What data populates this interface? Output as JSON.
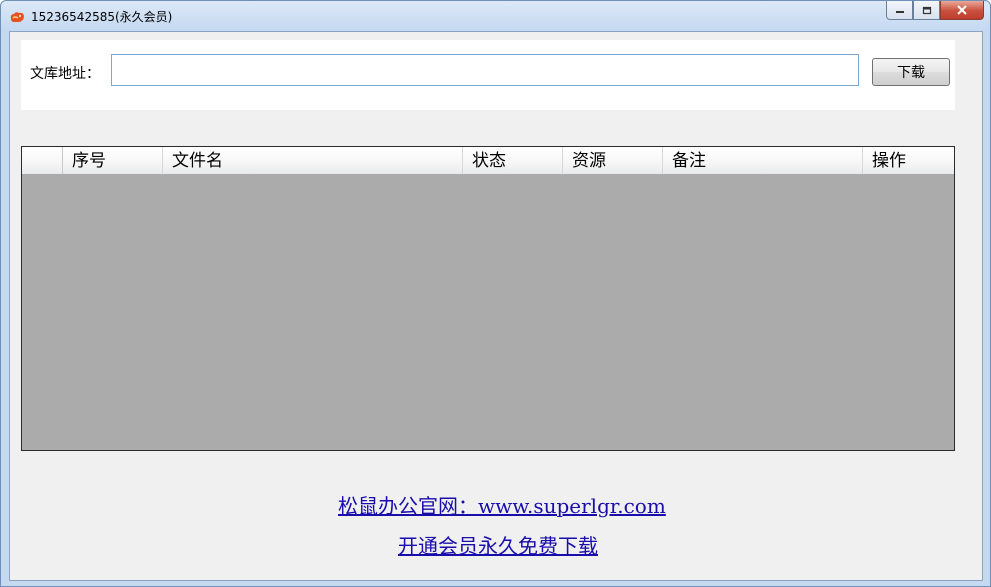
{
  "window": {
    "title": "15236542585(永久会员)",
    "controls": {
      "minimize": "minimize",
      "maximize": "maximize",
      "close": "close"
    }
  },
  "url_bar": {
    "label": "文库地址：",
    "value": "",
    "placeholder": "",
    "download_label": "下载"
  },
  "grid": {
    "columns": [
      "序号",
      "文件名",
      "状态",
      "资源",
      "备注",
      "操作"
    ],
    "rows": []
  },
  "links": {
    "website": "松鼠办公官网：www.superlgr.com",
    "membership": "开通会员永久免费下载"
  },
  "colors": {
    "link": "#1a0dab",
    "grid_background": "#ababab",
    "window_frame": "#c5d9f1",
    "close_button": "#c94f3c"
  },
  "icons": {
    "app": "squirrel-app-icon"
  }
}
